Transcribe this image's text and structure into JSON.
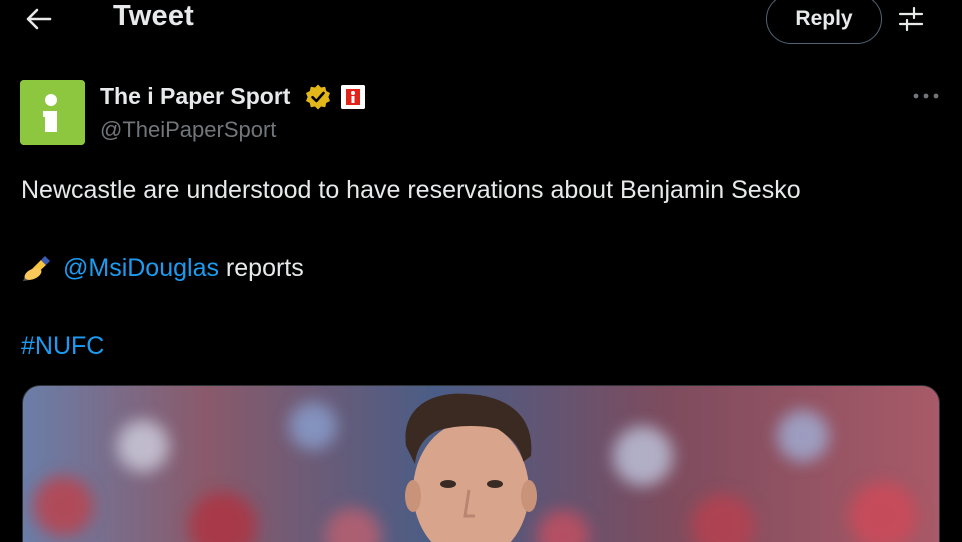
{
  "header": {
    "title": "Tweet",
    "reply_label": "Reply"
  },
  "author": {
    "name": "The i Paper Sport",
    "handle": "@TheiPaperSport",
    "avatar_letter": "i",
    "avatar_color": "#8dc63f",
    "verified_color": "#e2b719",
    "affiliate_color": "#e2231a"
  },
  "tweet": {
    "text_line1": "Newcastle are understood to have reservations about Benjamin Sesko",
    "emoji_icon": "writing-hand-icon",
    "mention": "@MsiDouglas",
    "mention_suffix": " reports",
    "hashtag": "#NUFC"
  },
  "colors": {
    "background": "#000000",
    "text": "#e7e9ea",
    "secondary_text": "#71767b",
    "link": "#1d9bf0",
    "border": "#536471"
  }
}
